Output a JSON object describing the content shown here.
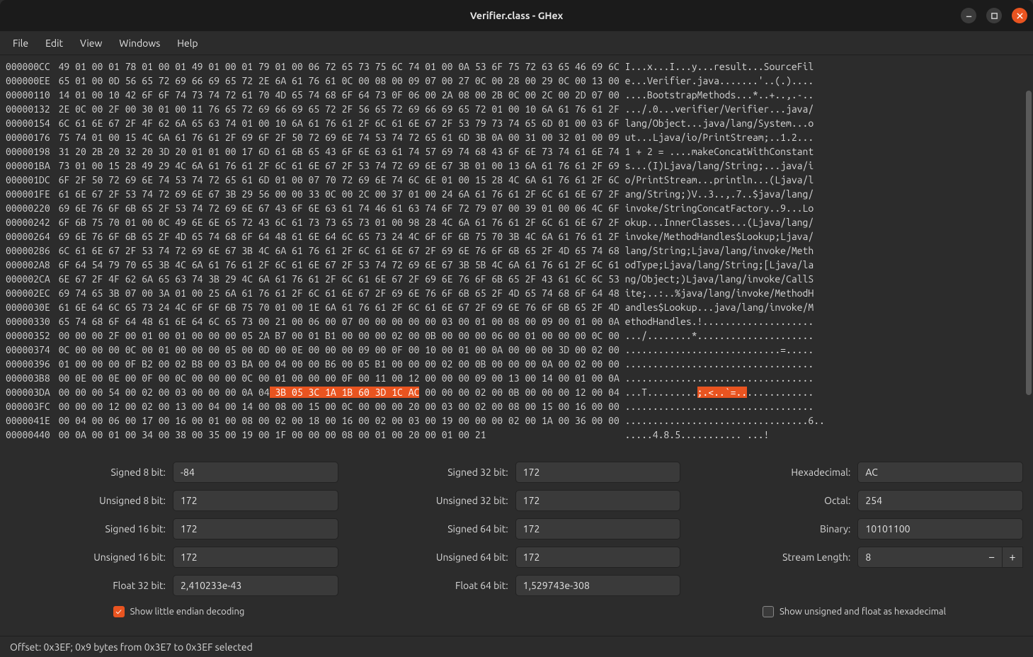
{
  "titlebar": {
    "title": "Verifier.class - GHex"
  },
  "menu": [
    "File",
    "Edit",
    "View",
    "Windows",
    "Help"
  ],
  "statusbar": {
    "text": "Offset: 0x3EF; 0x9 bytes from 0x3E7 to 0x3EF selected"
  },
  "inspector": {
    "col1": [
      {
        "label": "Signed 8 bit:",
        "value": "-84"
      },
      {
        "label": "Unsigned 8 bit:",
        "value": "172"
      },
      {
        "label": "Signed 16 bit:",
        "value": "172"
      },
      {
        "label": "Unsigned 16 bit:",
        "value": "172"
      },
      {
        "label": "Float 32 bit:",
        "value": "2,410233e-43"
      }
    ],
    "col2": [
      {
        "label": "Signed 32 bit:",
        "value": "172"
      },
      {
        "label": "Unsigned 32 bit:",
        "value": "172"
      },
      {
        "label": "Signed 64 bit:",
        "value": "172"
      },
      {
        "label": "Unsigned 64 bit:",
        "value": "172"
      },
      {
        "label": "Float 64 bit:",
        "value": "1,529743e-308"
      }
    ],
    "col3": [
      {
        "label": "Hexadecimal:",
        "value": "AC"
      },
      {
        "label": "Octal:",
        "value": "254"
      },
      {
        "label": "Binary:",
        "value": "10101100"
      },
      {
        "label": "Stream Length:",
        "value": "8",
        "stepper": true
      }
    ],
    "check_le": {
      "label": "Show little endian decoding",
      "checked": true
    },
    "check_hex": {
      "label": "Show unsigned and float as hexadecimal",
      "checked": false
    }
  },
  "hex": {
    "selection_row": 19,
    "selection_hex_start": 21,
    "selection_hex_end": 30,
    "selection_ascii_start": 21,
    "selection_ascii_end": 30,
    "rows": [
      {
        "addr": "000000CC",
        "bytes": "49 01 00 01 78 01 00 01 49 01 00 01 79 01 00 06 72 65 73 75 6C 74 01 00 0A 53 6F 75 72 63 65 46 69 6C",
        "ascii": "I...x...I...y...result...SourceFil"
      },
      {
        "addr": "000000EE",
        "bytes": "65 01 00 0D 56 65 72 69 66 69 65 72 2E 6A 61 76 61 0C 00 08 00 09 07 00 27 0C 00 28 00 29 0C 00 13 00",
        "ascii": "e...Verifier.java.......'..(.)...."
      },
      {
        "addr": "00000110",
        "bytes": "14 01 00 10 42 6F 6F 74 73 74 72 61 70 4D 65 74 68 6F 64 73 0F 06 00 2A 08 00 2B 0C 00 2C 00 2D 07 00",
        "ascii": "....BootstrapMethods...*..+..,.-.."
      },
      {
        "addr": "00000132",
        "bytes": "2E 0C 00 2F 00 30 01 00 11 76 65 72 69 66 69 65 72 2F 56 65 72 69 66 69 65 72 01 00 10 6A 61 76 61 2F",
        "ascii": ".../.0...verifier/Verifier...java/"
      },
      {
        "addr": "00000154",
        "bytes": "6C 61 6E 67 2F 4F 62 6A 65 63 74 01 00 10 6A 61 76 61 2F 6C 61 6E 67 2F 53 79 73 74 65 6D 01 00 03 6F",
        "ascii": "lang/Object...java/lang/System...o"
      },
      {
        "addr": "00000176",
        "bytes": "75 74 01 00 15 4C 6A 61 76 61 2F 69 6F 2F 50 72 69 6E 74 53 74 72 65 61 6D 3B 0A 00 31 00 32 01 00 09",
        "ascii": "ut...Ljava/io/PrintStream;..1.2..."
      },
      {
        "addr": "00000198",
        "bytes": "31 20 2B 20 32 20 3D 20 01 01 00 17 6D 61 6B 65 43 6F 6E 63 61 74 57 69 74 68 43 6F 6E 73 74 61 6E 74",
        "ascii": "1 + 2 = ....makeConcatWithConstant"
      },
      {
        "addr": "000001BA",
        "bytes": "73 01 00 15 28 49 29 4C 6A 61 76 61 2F 6C 61 6E 67 2F 53 74 72 69 6E 67 3B 01 00 13 6A 61 76 61 2F 69",
        "ascii": "s...(I)Ljava/lang/String;...java/i"
      },
      {
        "addr": "000001DC",
        "bytes": "6F 2F 50 72 69 6E 74 53 74 72 65 61 6D 01 00 07 70 72 69 6E 74 6C 6E 01 00 15 28 4C 6A 61 76 61 2F 6C",
        "ascii": "o/PrintStream...println...(Ljava/l"
      },
      {
        "addr": "000001FE",
        "bytes": "61 6E 67 2F 53 74 72 69 6E 67 3B 29 56 00 00 33 0C 00 2C 00 37 01 00 24 6A 61 76 61 2F 6C 61 6E 67 2F",
        "ascii": "ang/String;)V..3..,.7..$java/lang/"
      },
      {
        "addr": "00000220",
        "bytes": "69 6E 76 6F 6B 65 2F 53 74 72 69 6E 67 43 6F 6E 63 61 74 46 61 63 74 6F 72 79 07 00 39 01 00 06 4C 6F",
        "ascii": "invoke/StringConcatFactory..9...Lo"
      },
      {
        "addr": "00000242",
        "bytes": "6F 6B 75 70 01 00 0C 49 6E 6E 65 72 43 6C 61 73 73 65 73 01 00 98 28 4C 6A 61 76 61 2F 6C 61 6E 67 2F",
        "ascii": "okup...InnerClasses...(Ljava/lang/"
      },
      {
        "addr": "00000264",
        "bytes": "69 6E 76 6F 6B 65 2F 4D 65 74 68 6F 64 48 61 6E 64 6C 65 73 24 4C 6F 6F 6B 75 70 3B 4C 6A 61 76 61 2F",
        "ascii": "invoke/MethodHandles$Lookup;Ljava/"
      },
      {
        "addr": "00000286",
        "bytes": "6C 61 6E 67 2F 53 74 72 69 6E 67 3B 4C 6A 61 76 61 2F 6C 61 6E 67 2F 69 6E 76 6F 6B 65 2F 4D 65 74 68",
        "ascii": "lang/String;Ljava/lang/invoke/Meth"
      },
      {
        "addr": "000002A8",
        "bytes": "6F 64 54 79 70 65 3B 4C 6A 61 76 61 2F 6C 61 6E 67 2F 53 74 72 69 6E 67 3B 5B 4C 6A 61 76 61 2F 6C 61",
        "ascii": "odType;Ljava/lang/String;[Ljava/la"
      },
      {
        "addr": "000002CA",
        "bytes": "6E 67 2F 4F 62 6A 65 63 74 3B 29 4C 6A 61 76 61 2F 6C 61 6E 67 2F 69 6E 76 6F 6B 65 2F 43 61 6C 6C 53",
        "ascii": "ng/Object;)Ljava/lang/invoke/CallS"
      },
      {
        "addr": "000002EC",
        "bytes": "69 74 65 3B 07 00 3A 01 00 25 6A 61 76 61 2F 6C 61 6E 67 2F 69 6E 76 6F 6B 65 2F 4D 65 74 68 6F 64 48",
        "ascii": "ite;..:..%java/lang/invoke/MethodH"
      },
      {
        "addr": "0000030E",
        "bytes": "61 6E 64 6C 65 73 24 4C 6F 6F 6B 75 70 01 00 1E 6A 61 76 61 2F 6C 61 6E 67 2F 69 6E 76 6F 6B 65 2F 4D",
        "ascii": "andles$Lookup...java/lang/invoke/M"
      },
      {
        "addr": "00000330",
        "bytes": "65 74 68 6F 64 48 61 6E 64 6C 65 73 00 21 00 06 00 07 00 00 00 00 00 03 00 01 00 08 00 09 00 01 00 0A",
        "ascii": "ethodHandles.!...................."
      },
      {
        "addr": "00000352",
        "bytes": "00 00 00 2F 00 01 00 01 00 00 00 05 2A B7 00 01 B1 00 00 00 02 00 0B 00 00 00 06 00 01 00 00 00 0C 00",
        "ascii": ".../........*....................."
      },
      {
        "addr": "00000374",
        "bytes": "0C 00 00 00 0C 00 01 00 00 00 05 00 0D 00 0E 00 00 00 09 00 0F 00 10 00 01 00 0A 00 00 00 3D 00 02 00",
        "ascii": "............................=....."
      },
      {
        "addr": "00000396",
        "bytes": "01 00 00 00 0F B2 00 02 B8 00 03 BA 00 04 00 00 B6 00 05 B1 00 00 00 02 00 0B 00 00 00 0A 00 02 00 00",
        "ascii": ".................................."
      },
      {
        "addr": "000003B8",
        "bytes": "00 0E 00 0E 00 0F 00 0C 00 00 00 0C 00 01 00 00 00 0F 00 11 00 12 00 00 00 09 00 13 00 14 00 01 00 0A",
        "ascii": ".................................."
      },
      {
        "addr": "000003DA",
        "bytes": "00 00 00 54 00 02 00 03 00 00 00 0A 04 3B 05 3C 1A 1B 60 3D 1C AC 00 00 00 02 00 0B 00 00 00 12 00 04",
        "ascii": "...T.........;.<..`=.............."
      },
      {
        "addr": "000003FC",
        "bytes": "00 00 00 12 00 02 00 13 00 04 00 14 00 08 00 15 00 0C 00 00 00 20 00 03 00 02 00 08 00 15 00 16 00 00",
        "ascii": ".................................."
      },
      {
        "addr": "0000041E",
        "bytes": "00 04 00 06 00 17 00 16 00 01 00 08 00 02 00 18 00 16 00 02 00 03 00 19 00 00 00 02 00 1A 00 36 00 00",
        "ascii": ".................................6.."
      },
      {
        "addr": "00000440",
        "bytes": "00 0A 00 01 00 34 00 38 00 35 00 19 00 1F 00 00 00 08 00 01 00 20 00 01 00 21",
        "ascii": ".....4.8.5........... ...!"
      }
    ]
  }
}
